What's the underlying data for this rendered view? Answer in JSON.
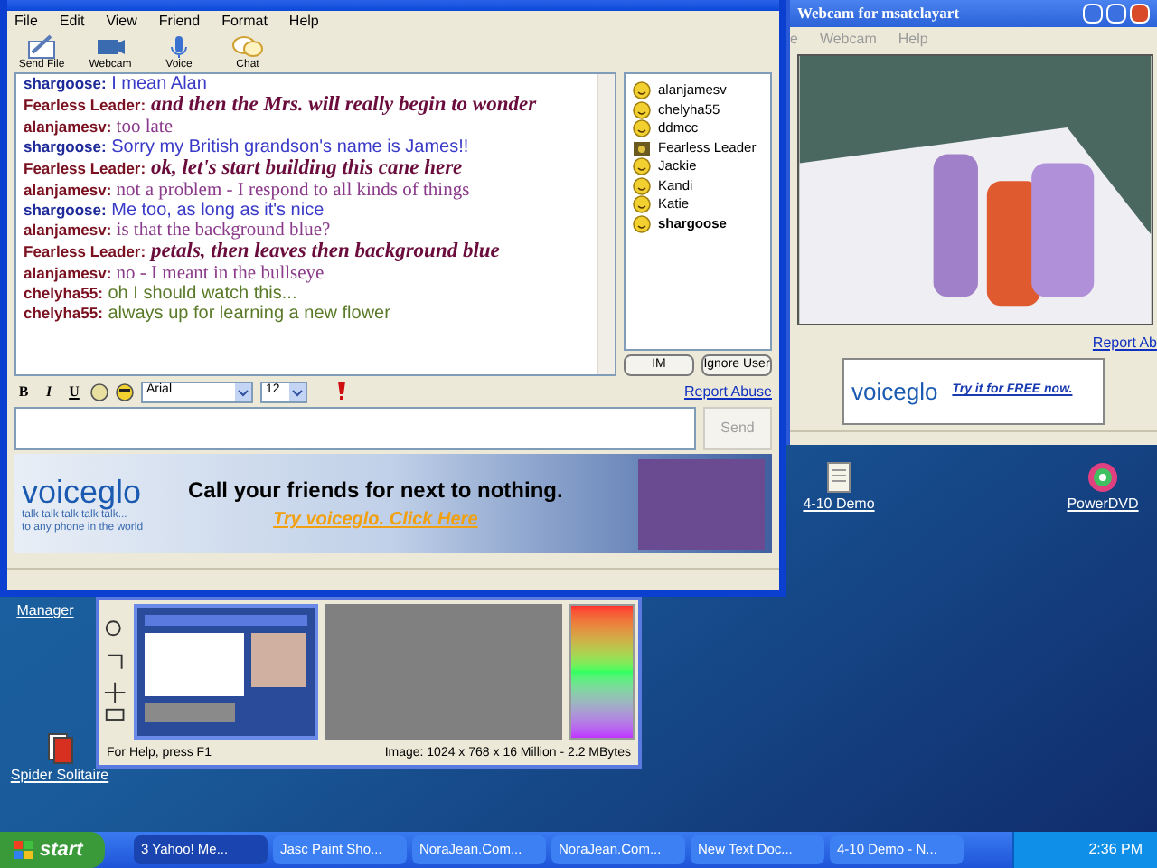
{
  "chat_window": {
    "menu": [
      "File",
      "Edit",
      "View",
      "Friend",
      "Format",
      "Help"
    ],
    "toolbar": [
      {
        "label": "Send File",
        "kind": "file"
      },
      {
        "label": "Webcam",
        "kind": "webcam"
      },
      {
        "label": "Voice",
        "kind": "voice"
      },
      {
        "label": "Chat",
        "kind": "chat"
      }
    ],
    "messages": [
      {
        "sender": {
          "name": "shargoose:",
          "color": "#1e2a9a"
        },
        "text": "I mean Alan",
        "kind": "sans",
        "color": "#3a3ac8"
      },
      {
        "sender": {
          "name": "Fearless Leader:",
          "color": "#7a1020"
        },
        "text": "and then the Mrs. will really begin to wonder",
        "kind": "script",
        "color": "#6a0c3c"
      },
      {
        "sender": {
          "name": "alanjamesv:",
          "color": "#7a1020"
        },
        "text": "too late",
        "kind": "serif",
        "color": "#8a3a8a"
      },
      {
        "sender": {
          "name": "shargoose:",
          "color": "#1e2a9a"
        },
        "text": "Sorry my British grandson's name is James!!",
        "kind": "sans",
        "color": "#3a3ac8"
      },
      {
        "sender": {
          "name": "Fearless Leader:",
          "color": "#7a1020"
        },
        "text": "ok, let's start building this cane here",
        "kind": "script",
        "color": "#6a0c3c"
      },
      {
        "sender": {
          "name": "alanjamesv:",
          "color": "#7a1020"
        },
        "text": "not a problem - I respond to all kinds of things",
        "kind": "serif",
        "color": "#8a3a8a"
      },
      {
        "sender": {
          "name": "shargoose:",
          "color": "#1e2a9a"
        },
        "text": "Me too, as long as it's nice",
        "kind": "sans",
        "color": "#3a3ac8"
      },
      {
        "sender": {
          "name": "alanjamesv:",
          "color": "#7a1020"
        },
        "text": "is that the background blue?",
        "kind": "serif",
        "color": "#8a3a8a"
      },
      {
        "sender": {
          "name": "Fearless Leader:",
          "color": "#7a1020"
        },
        "text": "petals, then leaves then background blue",
        "kind": "script",
        "color": "#6a0c3c"
      },
      {
        "sender": {
          "name": "alanjamesv:",
          "color": "#7a1020"
        },
        "text": "no - I meant in the bullseye",
        "kind": "serif",
        "color": "#8a3a8a"
      },
      {
        "sender": {
          "name": "chelyha55:",
          "color": "#7a1020"
        },
        "text": "oh I should watch this...",
        "kind": "sans",
        "color": "#5a7a28"
      },
      {
        "sender": {
          "name": "chelyha55:",
          "color": "#7a1020"
        },
        "text": "always up for learning a new flower",
        "kind": "sans",
        "color": "#5a7a28"
      }
    ],
    "users": [
      {
        "name": "alanjamesv",
        "kind": "smiley",
        "self": false
      },
      {
        "name": "chelyha55",
        "kind": "smiley",
        "self": false
      },
      {
        "name": "ddmcc",
        "kind": "smiley",
        "self": false
      },
      {
        "name": "Fearless Leader",
        "kind": "webcam",
        "self": false
      },
      {
        "name": "Jackie",
        "kind": "smiley",
        "self": false
      },
      {
        "name": "Kandi",
        "kind": "smiley",
        "self": false
      },
      {
        "name": "Katie",
        "kind": "smiley",
        "self": false
      },
      {
        "name": "shargoose",
        "kind": "smiley",
        "self": true
      }
    ],
    "user_buttons": [
      "IM",
      "Ignore User"
    ],
    "format_bar": {
      "bold": "B",
      "italic": "I",
      "underline": "U",
      "font": "Arial",
      "size": "12"
    },
    "report_abuse": "Report Abuse",
    "send": {
      "label": "Send",
      "disabled": true
    },
    "ad": {
      "logo": "voiceglo",
      "tagline_1": "talk talk talk talk talk...",
      "tagline_2": "to any phone in the world",
      "headline": "Call your friends for next to nothing.",
      "link": "Try voiceglo. Click Here"
    }
  },
  "webcam_window": {
    "title": "Webcam for msatclayart",
    "menu": [
      "e",
      "Webcam",
      "Help"
    ],
    "report_abuse": "Report Ab",
    "ad": {
      "logo": "voiceglo",
      "link": "Try it for FREE now."
    }
  },
  "desktop_icons": [
    {
      "label": "4-10 Demo",
      "kind": "document"
    },
    {
      "label": "PowerDVD",
      "kind": "disc"
    },
    {
      "label": "Manager",
      "kind": "none"
    },
    {
      "label": "Spider Solitaire",
      "kind": "cards"
    }
  ],
  "paint_window": {
    "help": "For Help, press F1",
    "image_info": "Image:  1024 x 768 x 16 Million - 2.2 MBytes"
  },
  "taskbar": {
    "start": "start",
    "items": [
      {
        "label": "3 Yahoo! Me...",
        "selected": true
      },
      {
        "label": "Jasc Paint Sho...",
        "selected": false
      },
      {
        "label": "NoraJean.Com...",
        "selected": false
      },
      {
        "label": "NoraJean.Com...",
        "selected": false
      },
      {
        "label": "New Text Doc...",
        "selected": false
      },
      {
        "label": "4-10 Demo - N...",
        "selected": false
      }
    ],
    "clock": "2:36 PM"
  }
}
